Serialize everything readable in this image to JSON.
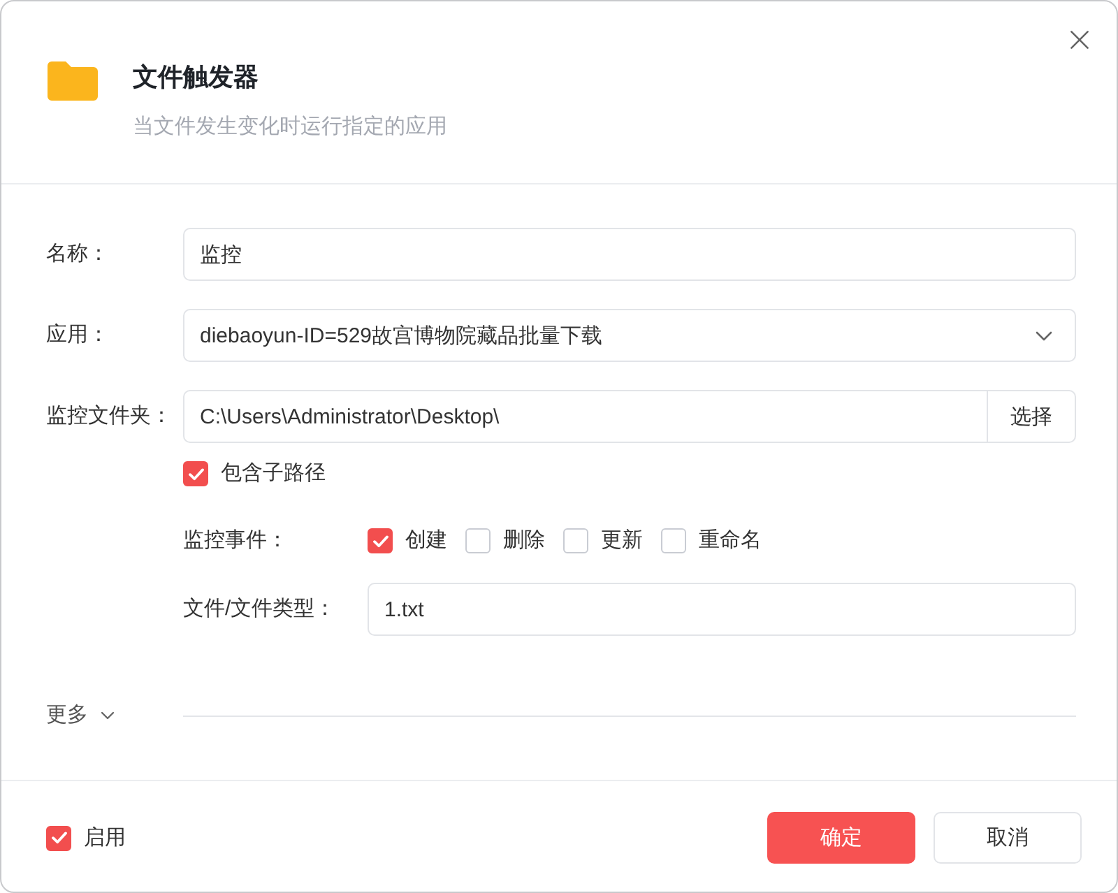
{
  "dialog": {
    "title": "文件触发器",
    "subtitle": "当文件发生变化时运行指定的应用"
  },
  "form": {
    "name": {
      "label": "名称：",
      "value": "监控"
    },
    "app": {
      "label": "应用：",
      "value": "diebaoyun-ID=529故宫博物院藏品批量下载"
    },
    "folder": {
      "label": "监控文件夹：",
      "value": "C:\\Users\\Administrator\\Desktop\\",
      "button": "选择",
      "include_subpaths": {
        "label": "包含子路径",
        "checked": true
      }
    },
    "events": {
      "label": "监控事件：",
      "options": [
        {
          "label": "创建",
          "checked": true
        },
        {
          "label": "删除",
          "checked": false
        },
        {
          "label": "更新",
          "checked": false
        },
        {
          "label": "重命名",
          "checked": false
        }
      ]
    },
    "file_type": {
      "label": "文件/文件类型：",
      "value": "1.txt"
    },
    "more": {
      "label": "更多",
      "expanded": false
    }
  },
  "footer": {
    "enabled": {
      "label": "启用",
      "checked": true
    },
    "buttons": [
      {
        "label": "确定",
        "kind": "primary"
      },
      {
        "label": "取消",
        "kind": "secondary"
      }
    ]
  }
}
